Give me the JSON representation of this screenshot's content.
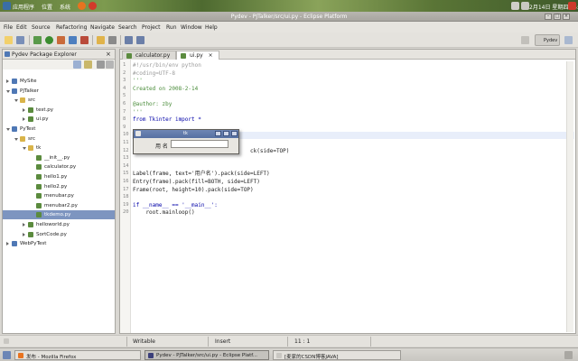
{
  "system_bar": {
    "apps_label": "应用程序",
    "places_label": "位置",
    "system_label": "系统",
    "clock": "2月14日 星期四 15:39"
  },
  "window": {
    "title": "Pydev - PJTalker/src/ui.py - Eclipse Platform"
  },
  "menubar": {
    "items": [
      "File",
      "Edit",
      "Source",
      "Refactoring",
      "Navigate",
      "Search",
      "Project",
      "Run",
      "Window",
      "Help"
    ]
  },
  "perspective": {
    "label": "Pydev"
  },
  "explorer": {
    "title": "Pydev Package Explorer",
    "close": "×",
    "tree": [
      {
        "label": "MySite",
        "depth": 0,
        "expanded": false,
        "kind": "project"
      },
      {
        "label": "PJTalker",
        "depth": 0,
        "expanded": true,
        "kind": "project"
      },
      {
        "label": "src",
        "depth": 1,
        "expanded": true,
        "kind": "folder"
      },
      {
        "label": "test.py",
        "depth": 2,
        "expanded": false,
        "kind": "py"
      },
      {
        "label": "ui.py",
        "depth": 2,
        "expanded": false,
        "kind": "py"
      },
      {
        "label": "PyTest",
        "depth": 0,
        "expanded": true,
        "kind": "project"
      },
      {
        "label": "src",
        "depth": 1,
        "expanded": true,
        "kind": "folder"
      },
      {
        "label": "tk",
        "depth": 2,
        "expanded": true,
        "kind": "folder"
      },
      {
        "label": "__init__.py",
        "depth": 3,
        "expanded": false,
        "kind": "py"
      },
      {
        "label": "calculator.py",
        "depth": 3,
        "expanded": false,
        "kind": "py"
      },
      {
        "label": "hello1.py",
        "depth": 3,
        "expanded": false,
        "kind": "py"
      },
      {
        "label": "hello2.py",
        "depth": 3,
        "expanded": false,
        "kind": "py"
      },
      {
        "label": "menubar.py",
        "depth": 3,
        "expanded": false,
        "kind": "py"
      },
      {
        "label": "menubar2.py",
        "depth": 3,
        "expanded": false,
        "kind": "py"
      },
      {
        "label": "tkdemo.py",
        "depth": 3,
        "expanded": false,
        "kind": "py",
        "selected": true
      },
      {
        "label": "helloworld.py",
        "depth": 2,
        "expanded": false,
        "kind": "py"
      },
      {
        "label": "SortCode.py",
        "depth": 2,
        "expanded": false,
        "kind": "py"
      },
      {
        "label": "WebPyTest",
        "depth": 0,
        "expanded": false,
        "kind": "project"
      }
    ]
  },
  "editor": {
    "tabs": [
      {
        "label": "calculator.py",
        "active": false
      },
      {
        "label": "ui.py",
        "active": true
      }
    ],
    "lines": [
      {
        "n": "1",
        "text": "#!/usr/bin/env python",
        "cls": "c-gray"
      },
      {
        "n": "2",
        "text": "#coding=UTF-8",
        "cls": "c-gray"
      },
      {
        "n": "3",
        "text": "'''",
        "cls": "c-green"
      },
      {
        "n": "4",
        "text": "Created on 2008-2-14",
        "cls": "c-green"
      },
      {
        "n": "5",
        "text": "",
        "cls": ""
      },
      {
        "n": "6",
        "text": "@author: zby",
        "cls": "c-green"
      },
      {
        "n": "7",
        "text": "'''",
        "cls": "c-green"
      },
      {
        "n": "8",
        "text": "from Tkinter import *",
        "cls": "c-kw"
      },
      {
        "n": "9",
        "text": "",
        "cls": ""
      },
      {
        "n": "10",
        "text": "root = Tk()",
        "cls": ""
      },
      {
        "n": "11",
        "text": "",
        "cls": ""
      },
      {
        "n": "12",
        "text": "                                    ck(side=TOP)",
        "cls": ""
      },
      {
        "n": "13",
        "text": "",
        "cls": ""
      },
      {
        "n": "14",
        "text": "",
        "cls": ""
      },
      {
        "n": "15",
        "text": "Label(frame, text='用户名').pack(side=LEFT)",
        "cls": ""
      },
      {
        "n": "16",
        "text": "Entry(frame).pack(fill=BOTH, side=LEFT)",
        "cls": ""
      },
      {
        "n": "17",
        "text": "Frame(root, height=10).pack(side=TOP)",
        "cls": ""
      },
      {
        "n": "18",
        "text": "",
        "cls": ""
      },
      {
        "n": "19",
        "text": "if __name__ == '__main__':",
        "cls": "c-kw"
      },
      {
        "n": "20",
        "text": "    root.mainloop()",
        "cls": ""
      }
    ]
  },
  "tk_window": {
    "title": "tk",
    "label": "用 名",
    "entry_value": ""
  },
  "statusbar": {
    "writable": "Writable",
    "insert_mode": "Insert",
    "position": "11 : 1"
  },
  "taskbar": {
    "tasks": [
      {
        "label": "发布 - Mozilla Firefox",
        "active": false
      },
      {
        "label": "Pydev - PJTalker/src/ui.py - Eclipse Platf...",
        "active": true
      },
      {
        "label": "[麦家的CSDN博客JAVA]",
        "active": false
      }
    ]
  },
  "colors": {
    "selection": "#7d95c0",
    "tk_title": "#5670a2",
    "keyword": "#0000a8",
    "comment": "#4a8c3a"
  }
}
